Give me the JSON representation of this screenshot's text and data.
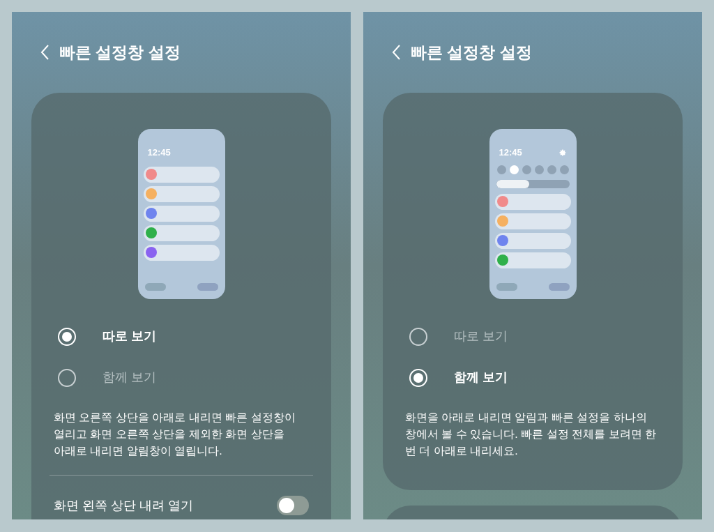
{
  "screens": [
    {
      "title": "빠른 설정창 설정",
      "preview": {
        "kind": "separate",
        "time": "12:45",
        "tiles": [
          {
            "color": "#f08a8a"
          },
          {
            "color": "#f5b060"
          },
          {
            "color": "#6f84ee"
          },
          {
            "color": "#2fb04a"
          },
          {
            "color": "#8a63f0"
          }
        ]
      },
      "options": [
        {
          "label": "따로 보기",
          "selected": true
        },
        {
          "label": "함께 보기",
          "selected": false
        }
      ],
      "description": "화면 오른쪽 상단을 아래로 내리면 빠른 설정창이 열리고 화면 오른쪽 상단을 제외한 화면 상단을 아래로 내리면 알림창이 열립니다.",
      "toggle": {
        "label": "화면 왼쪽 상단 내려 열기",
        "on": false
      }
    },
    {
      "title": "빠른 설정창 설정",
      "preview": {
        "kind": "together",
        "time": "12:45",
        "quick_toggles": [
          {
            "on": false
          },
          {
            "on": true
          },
          {
            "on": false
          },
          {
            "on": false
          },
          {
            "on": false
          },
          {
            "on": false
          }
        ],
        "brightness": {
          "level": 0.45
        },
        "tiles": [
          {
            "color": "#f08a8a"
          },
          {
            "color": "#f5b060"
          },
          {
            "color": "#6f84ee"
          },
          {
            "color": "#2fb04a"
          }
        ]
      },
      "options": [
        {
          "label": "따로 보기",
          "selected": false
        },
        {
          "label": "함께 보기",
          "selected": true
        }
      ],
      "description": "화면을 아래로 내리면 알림과 빠른 설정을 하나의 창에서 볼 수 있습니다. 빠른 설정 전체를 보려면 한 번 더 아래로 내리세요.",
      "more_below": true
    }
  ]
}
